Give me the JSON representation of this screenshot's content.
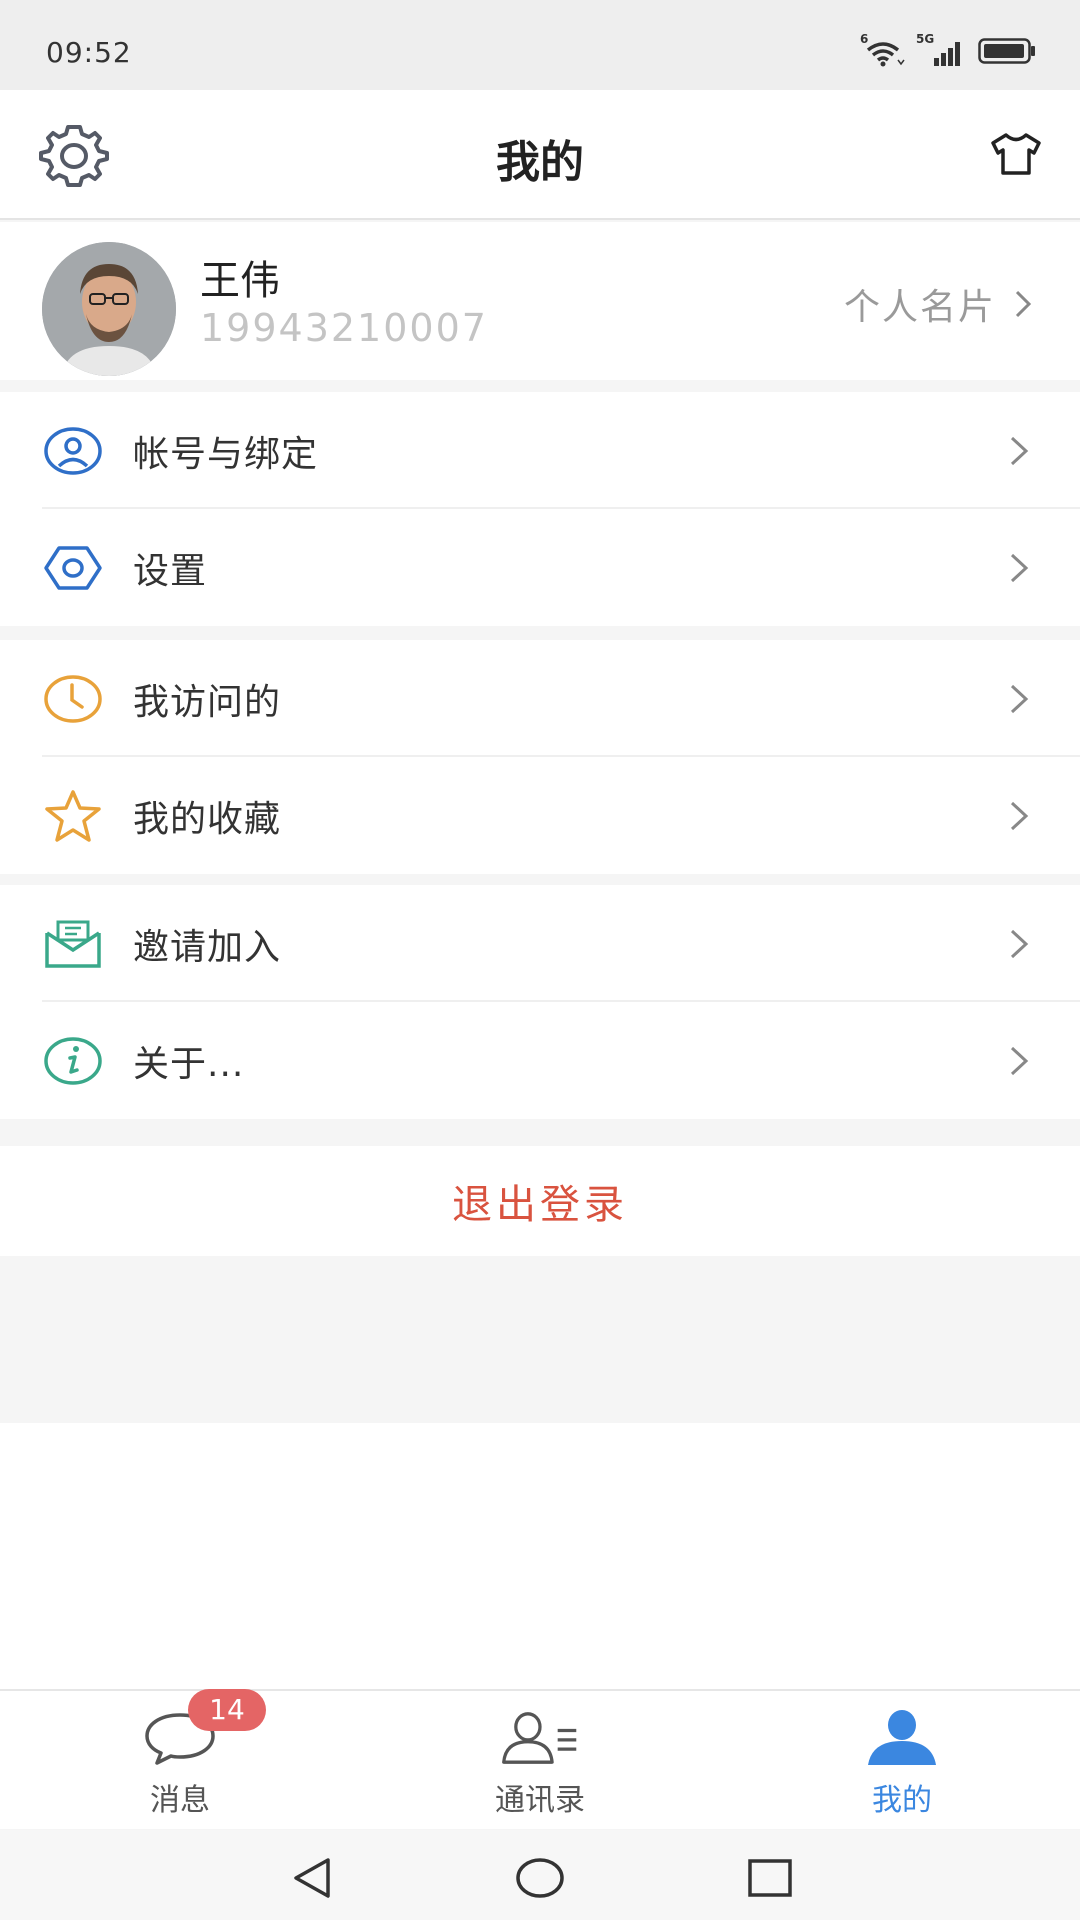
{
  "status_bar": {
    "time": "09:52",
    "wifi_tag": "6",
    "network_tag": "5G",
    "icons": [
      "wifi-icon",
      "signal-icon",
      "battery-icon"
    ]
  },
  "header": {
    "title": "我的",
    "left_icon": "gear-icon",
    "right_icon": "tshirt-icon"
  },
  "profile": {
    "name": "王伟",
    "phone": "19943210007",
    "card_link_label": "个人名片"
  },
  "menu_groups": [
    {
      "items": [
        {
          "label": "帐号与绑定",
          "icon": "account-icon",
          "color": "#2f6fc8"
        },
        {
          "label": "设置",
          "icon": "hexagon-settings-icon",
          "color": "#2f6fc8"
        }
      ]
    },
    {
      "items": [
        {
          "label": "我访问的",
          "icon": "clock-icon",
          "color": "#e8a23a"
        },
        {
          "label": "我的收藏",
          "icon": "star-icon",
          "color": "#e8a23a"
        }
      ]
    },
    {
      "items": [
        {
          "label": "邀请加入",
          "icon": "envelope-icon",
          "color": "#3aa88a"
        },
        {
          "label": "关于...",
          "icon": "info-icon",
          "color": "#3aa88a"
        }
      ]
    }
  ],
  "logout": {
    "label": "退出登录",
    "color": "#d9533f"
  },
  "tabbar": {
    "tabs": [
      {
        "label": "消息",
        "icon": "chat-bubble-icon",
        "badge": "14",
        "active": false
      },
      {
        "label": "通讯录",
        "icon": "contacts-icon",
        "active": false
      },
      {
        "label": "我的",
        "icon": "person-icon",
        "active": true
      }
    ],
    "active_color": "#3b87e0",
    "badge_color": "#e46565"
  },
  "system_nav": {
    "buttons": [
      "back-icon",
      "home-icon",
      "recents-icon"
    ]
  }
}
